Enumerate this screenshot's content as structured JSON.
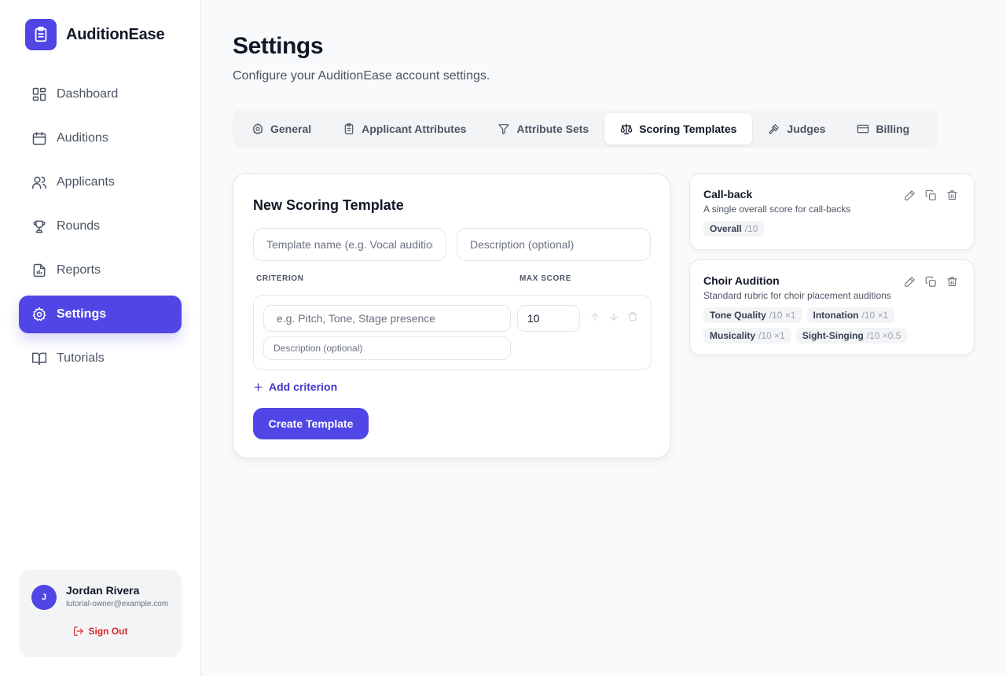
{
  "app": {
    "name": "AuditionEase",
    "logo_icon": "clipboard-list-icon",
    "accent": "#4f46e5"
  },
  "sidebar": {
    "items": [
      {
        "label": "Dashboard",
        "icon": "layout-dashboard-icon",
        "active": false
      },
      {
        "label": "Auditions",
        "icon": "calendar-icon",
        "active": false
      },
      {
        "label": "Applicants",
        "icon": "users-icon",
        "active": false
      },
      {
        "label": "Rounds",
        "icon": "trophy-icon",
        "active": false
      },
      {
        "label": "Reports",
        "icon": "file-chart-icon",
        "active": false
      },
      {
        "label": "Settings",
        "icon": "gear-icon",
        "active": true
      },
      {
        "label": "Tutorials",
        "icon": "book-open-icon",
        "active": false
      }
    ]
  },
  "user": {
    "initial": "J",
    "name": "Jordan Rivera",
    "email": "tutorial-owner@example.com",
    "signout_label": "Sign Out"
  },
  "page": {
    "title": "Settings",
    "subtitle": "Configure your AuditionEase account settings."
  },
  "tabs": [
    {
      "label": "General",
      "icon": "gear-icon",
      "active": false
    },
    {
      "label": "Applicant Attributes",
      "icon": "clipboard-icon",
      "active": false
    },
    {
      "label": "Attribute Sets",
      "icon": "filter-icon",
      "active": false
    },
    {
      "label": "Scoring Templates",
      "icon": "scale-icon",
      "active": true
    },
    {
      "label": "Judges",
      "icon": "gavel-icon",
      "active": false
    },
    {
      "label": "Billing",
      "icon": "credit-card-icon",
      "active": false
    }
  ],
  "form": {
    "title": "New Scoring Template",
    "name_placeholder": "Template name (e.g. Vocal audition)",
    "description_placeholder": "Description (optional)",
    "criterion_header": "CRITERION",
    "max_score_header": "MAX SCORE",
    "criterion_placeholder": "e.g. Pitch, Tone, Stage presence",
    "criterion_desc_placeholder": "Description (optional)",
    "max_score_value": "10",
    "add_label": "Add criterion",
    "create_label": "Create Template"
  },
  "templates": [
    {
      "name": "Call-back",
      "description": "A single overall score for call-backs",
      "criteria": [
        {
          "name": "Overall",
          "meta": "/10"
        }
      ]
    },
    {
      "name": "Choir Audition",
      "description": "Standard rubric for choir placement auditions",
      "criteria": [
        {
          "name": "Tone Quality",
          "meta": "/10 ×1"
        },
        {
          "name": "Intonation",
          "meta": "/10 ×1"
        },
        {
          "name": "Musicality",
          "meta": "/10 ×1"
        },
        {
          "name": "Sight-Singing",
          "meta": "/10 ×0.5"
        }
      ]
    }
  ]
}
